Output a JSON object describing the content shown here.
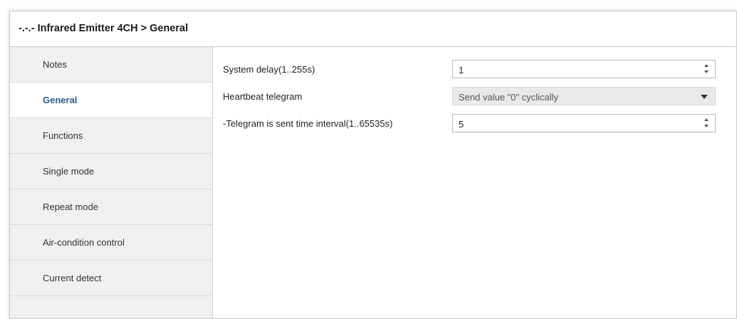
{
  "window": {
    "title": "-.-.- Infrared Emitter 4CH > General"
  },
  "sidebar": {
    "items": [
      {
        "label": "Notes"
      },
      {
        "label": "General",
        "active": true
      },
      {
        "label": "Functions"
      },
      {
        "label": "Single mode"
      },
      {
        "label": "Repeat mode"
      },
      {
        "label": "Air-condition control"
      },
      {
        "label": "Current detect"
      }
    ]
  },
  "params": {
    "system_delay": {
      "label": "System delay(1..255s)",
      "value": "1"
    },
    "heartbeat": {
      "label": "Heartbeat telegram",
      "value": "Send value \"0\" cyclically"
    },
    "interval": {
      "label": "-Telegram is sent time interval(1..65535s)",
      "value": "5"
    }
  },
  "icons": {
    "spin_up": "spin-up-icon",
    "spin_down": "spin-down-icon",
    "dropdown": "chevron-down-icon"
  },
  "colors": {
    "active_nav_text": "#2a5d8f",
    "sidebar_bg": "#f0f0f0",
    "select_bg": "#e9e9e9"
  }
}
